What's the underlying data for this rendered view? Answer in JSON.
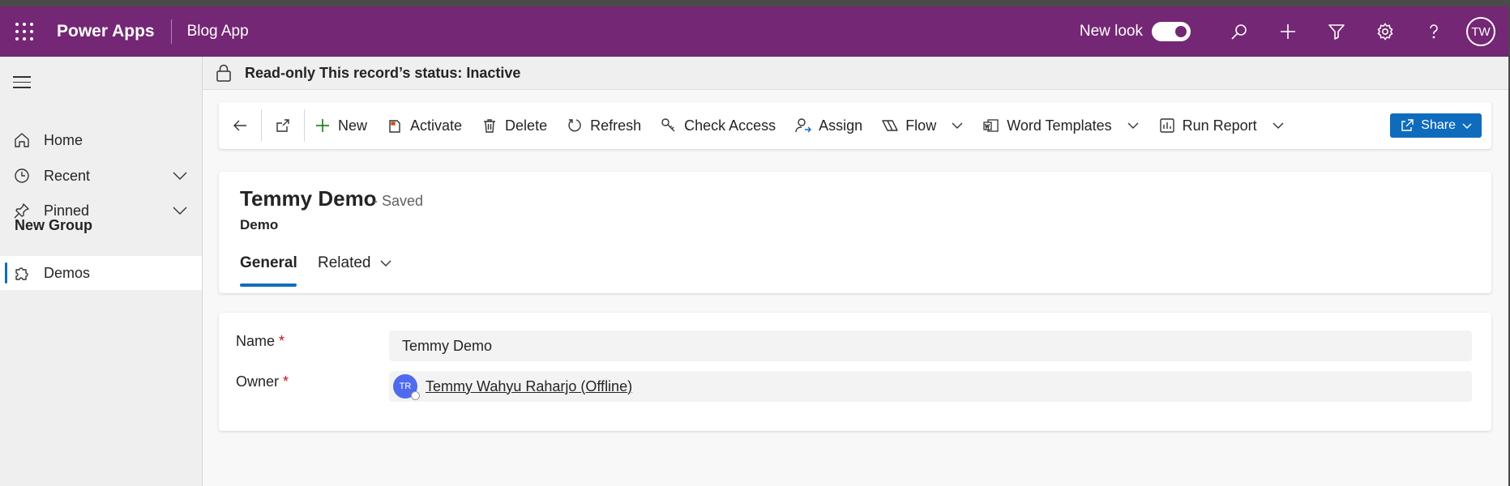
{
  "header": {
    "app_name": "Power Apps",
    "app_module": "Blog App",
    "new_look_label": "New look",
    "new_look_on": true,
    "avatar_initials": "TW",
    "icons": [
      "waffle-icon",
      "search-icon",
      "add-icon",
      "filter-icon",
      "settings-icon",
      "help-icon"
    ]
  },
  "sidebar": {
    "items": [
      {
        "label": "Home",
        "icon": "home-icon"
      },
      {
        "label": "Recent",
        "icon": "clock-icon"
      },
      {
        "label": "Pinned",
        "icon": "pin-icon"
      }
    ],
    "group_title": "New Group",
    "group_items": [
      {
        "label": "Demos",
        "icon": "puzzle-icon",
        "selected": true
      }
    ]
  },
  "status_bar": {
    "text": "Read-only This record’s status: Inactive"
  },
  "command_bar": {
    "new": "New",
    "activate": "Activate",
    "delete": "Delete",
    "refresh": "Refresh",
    "check_access": "Check Access",
    "assign": "Assign",
    "flow": "Flow",
    "word_templates": "Word Templates",
    "run_report": "Run Report",
    "share": "Share"
  },
  "record": {
    "title": "Temmy Demo",
    "saved_status": "- Saved",
    "entity": "Demo",
    "tabs": [
      "General",
      "Related"
    ]
  },
  "form": {
    "name_label": "Name",
    "name_value": "Temmy Demo",
    "owner_label": "Owner",
    "owner_initials": "TR",
    "owner_value": "Temmy Wahyu Raharjo (Offline)",
    "required_marker": "*"
  },
  "colors": {
    "brand": "#742774",
    "accent": "#0f6cbd",
    "required": "#c50f1f"
  }
}
